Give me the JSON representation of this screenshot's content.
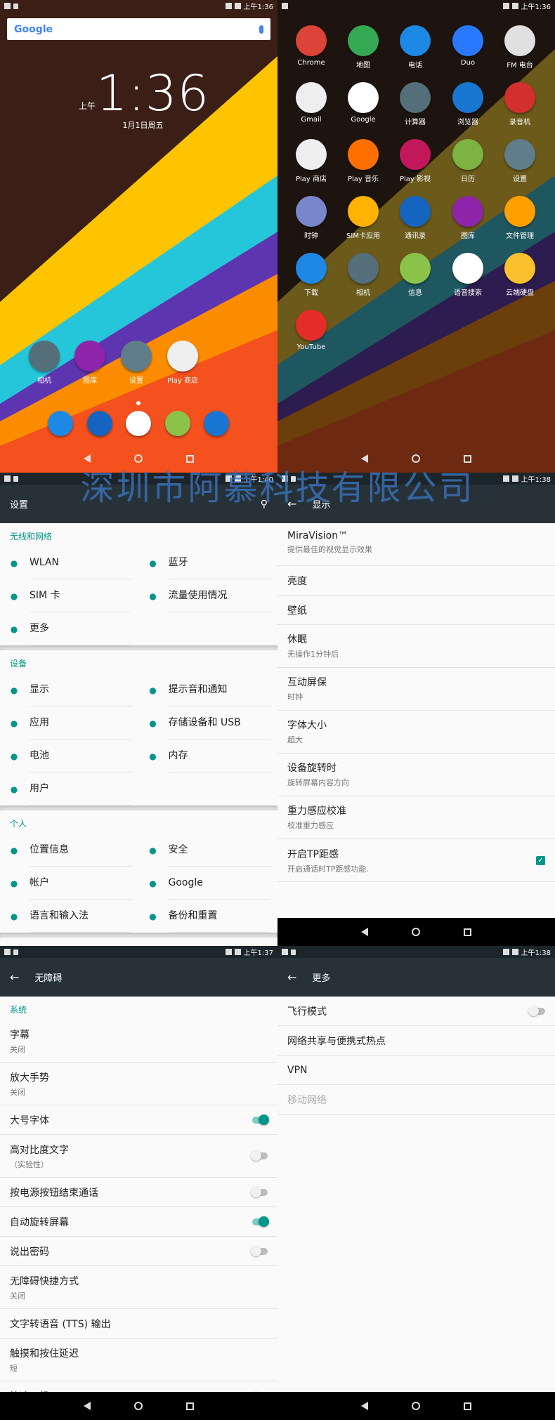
{
  "panel_home": {
    "status_time": "上午1:36",
    "search_logo": "Google",
    "clock": {
      "ampm": "上午",
      "time": "1:36",
      "date": "1月1日周五"
    },
    "favorites": [
      {
        "label": "相机",
        "icon": "camera-icon",
        "color": "#546e7a"
      },
      {
        "label": "图库",
        "icon": "gallery-icon",
        "color": "#8e24aa"
      },
      {
        "label": "设置",
        "icon": "gear-icon",
        "color": "#607d8b"
      },
      {
        "label": "Play 商店",
        "icon": "play-store-icon",
        "color": "#eeeeee"
      }
    ],
    "dock": [
      {
        "icon": "phone-icon",
        "color": "#1e88e5"
      },
      {
        "icon": "contacts-icon",
        "color": "#1565c0"
      },
      {
        "icon": "app-drawer-icon",
        "color": "#ffffff"
      },
      {
        "icon": "messaging-icon",
        "color": "#8bc34a"
      },
      {
        "icon": "browser-icon",
        "color": "#1976d2"
      }
    ]
  },
  "panel_drawer": {
    "status_time": "上午1:36",
    "apps": [
      {
        "label": "Chrome",
        "icon": "chrome-icon",
        "color": "#db4437"
      },
      {
        "label": "地图",
        "icon": "maps-icon",
        "color": "#34a853"
      },
      {
        "label": "电话",
        "icon": "phone-icon",
        "color": "#1e88e5"
      },
      {
        "label": "Duo",
        "icon": "duo-icon",
        "color": "#2979ff"
      },
      {
        "label": "FM 电台",
        "icon": "radio-icon",
        "color": "#e0e0e0"
      },
      {
        "label": "Gmail",
        "icon": "gmail-icon",
        "color": "#eeeeee"
      },
      {
        "label": "Google",
        "icon": "google-icon",
        "color": "#ffffff"
      },
      {
        "label": "计算器",
        "icon": "calculator-icon",
        "color": "#546e7a"
      },
      {
        "label": "浏览器",
        "icon": "browser-icon",
        "color": "#1976d2"
      },
      {
        "label": "录音机",
        "icon": "recorder-icon",
        "color": "#d32f2f"
      },
      {
        "label": "Play 商店",
        "icon": "play-store-icon",
        "color": "#eeeeee"
      },
      {
        "label": "Play 音乐",
        "icon": "play-music-icon",
        "color": "#ff6f00"
      },
      {
        "label": "Play 影视",
        "icon": "play-movies-icon",
        "color": "#c2185b"
      },
      {
        "label": "日历",
        "icon": "calendar-icon",
        "color": "#7cb342"
      },
      {
        "label": "设置",
        "icon": "gear-icon",
        "color": "#607d8b"
      },
      {
        "label": "时钟",
        "icon": "clock-icon",
        "color": "#7986cb"
      },
      {
        "label": "SIM卡应用",
        "icon": "sim-app-icon",
        "color": "#ffb300"
      },
      {
        "label": "通讯录",
        "icon": "contacts-icon",
        "color": "#1565c0"
      },
      {
        "label": "图库",
        "icon": "gallery-icon",
        "color": "#8e24aa"
      },
      {
        "label": "文件管理",
        "icon": "file-manager-icon",
        "color": "#ffa000"
      },
      {
        "label": "下载",
        "icon": "download-icon",
        "color": "#1e88e5"
      },
      {
        "label": "相机",
        "icon": "camera-icon",
        "color": "#546e7a"
      },
      {
        "label": "信息",
        "icon": "messaging-icon",
        "color": "#8bc34a"
      },
      {
        "label": "语音搜索",
        "icon": "voice-search-icon",
        "color": "#ffffff"
      },
      {
        "label": "云端硬盘",
        "icon": "drive-icon",
        "color": "#fbc02d"
      },
      {
        "label": "YouTube",
        "icon": "youtube-icon",
        "color": "#e52d27"
      }
    ]
  },
  "watermark": "深圳市阿慕科技有限公司",
  "panel_settings": {
    "status_time": "上午1:40",
    "title": "设置",
    "sections": [
      {
        "header": "无线和网络",
        "items": [
          {
            "label": "WLAN",
            "icon": "wifi-icon"
          },
          {
            "label": "蓝牙",
            "icon": "bluetooth-icon"
          },
          {
            "label": "SIM 卡",
            "icon": "sim-card-icon"
          },
          {
            "label": "流量使用情况",
            "icon": "data-usage-icon"
          },
          {
            "label": "更多",
            "icon": "more-icon"
          }
        ]
      },
      {
        "header": "设备",
        "items": [
          {
            "label": "显示",
            "icon": "display-icon"
          },
          {
            "label": "提示音和通知",
            "icon": "bell-icon"
          },
          {
            "label": "应用",
            "icon": "android-icon"
          },
          {
            "label": "存储设备和 USB",
            "icon": "storage-icon"
          },
          {
            "label": "电池",
            "icon": "battery-icon"
          },
          {
            "label": "内存",
            "icon": "memory-icon"
          },
          {
            "label": "用户",
            "icon": "user-icon"
          }
        ]
      },
      {
        "header": "个人",
        "items": [
          {
            "label": "位置信息",
            "icon": "location-icon"
          },
          {
            "label": "安全",
            "icon": "lock-icon"
          },
          {
            "label": "帐户",
            "icon": "account-icon"
          },
          {
            "label": "Google",
            "icon": "google-g-icon"
          },
          {
            "label": "语言和输入法",
            "icon": "globe-icon"
          },
          {
            "label": "备份和重置",
            "icon": "backup-icon"
          }
        ]
      }
    ]
  },
  "panel_display": {
    "status_time": "上午1:38",
    "title": "显示",
    "items": [
      {
        "title": "MiraVision™",
        "subtitle": "提供最佳的视觉显示效果"
      },
      {
        "title": "亮度",
        "subtitle": ""
      },
      {
        "title": "壁纸",
        "subtitle": ""
      },
      {
        "title": "休眠",
        "subtitle": "无操作1分钟后"
      },
      {
        "title": "互动屏保",
        "subtitle": "时钟"
      },
      {
        "title": "字体大小",
        "subtitle": "超大"
      },
      {
        "title": "设备旋转时",
        "subtitle": "旋转屏幕内容方向"
      },
      {
        "title": "重力感应校准",
        "subtitle": "校准重力感应"
      },
      {
        "title": "开启TP距感",
        "subtitle": "开启通话时TP距感功能.",
        "checked": true
      }
    ]
  },
  "panel_accessibility": {
    "status_time": "上午1:37",
    "title": "无障碍",
    "section": "系统",
    "items": [
      {
        "title": "字幕",
        "subtitle": "关闭"
      },
      {
        "title": "放大手势",
        "subtitle": "关闭"
      },
      {
        "title": "大号字体",
        "subtitle": "",
        "switch": "on"
      },
      {
        "title": "高对比度文字",
        "subtitle": "（实验性）",
        "switch": "off"
      },
      {
        "title": "按电源按钮结束通话",
        "subtitle": "",
        "switch": "off"
      },
      {
        "title": "自动旋转屏幕",
        "subtitle": "",
        "switch": "on"
      },
      {
        "title": "说出密码",
        "subtitle": "",
        "switch": "off"
      },
      {
        "title": "无障碍快捷方式",
        "subtitle": "关闭"
      },
      {
        "title": "文字转语音 (TTS) 输出",
        "subtitle": ""
      },
      {
        "title": "触摸和按住延迟",
        "subtitle": "短"
      },
      {
        "title": "快速开机",
        "subtitle": "",
        "switch": "off"
      }
    ]
  },
  "panel_more": {
    "status_time": "上午1:38",
    "title": "更多",
    "items": [
      {
        "title": "飞行模式",
        "switch": "off"
      },
      {
        "title": "网络共享与便携式热点"
      },
      {
        "title": "VPN"
      },
      {
        "title": "移动网络",
        "disabled": true
      }
    ]
  }
}
